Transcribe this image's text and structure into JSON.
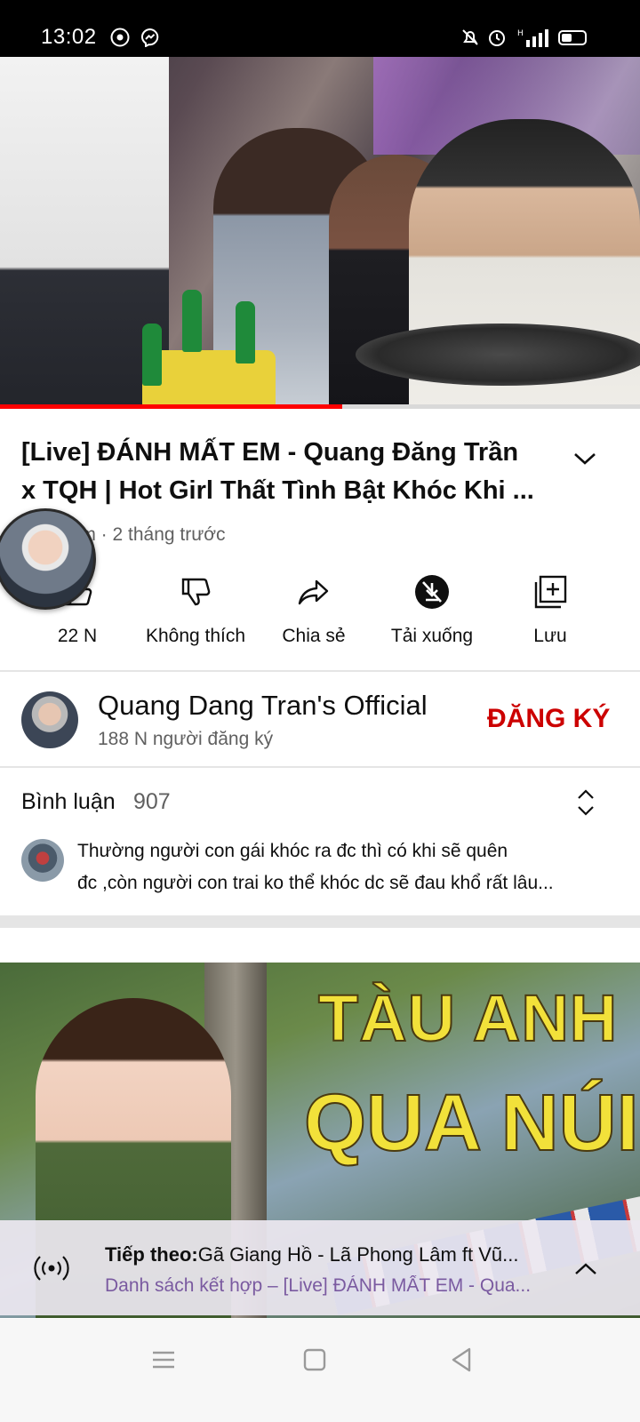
{
  "status_bar": {
    "time": "13:02",
    "icons": [
      "chrome-icon",
      "messenger-icon",
      "mute-icon",
      "alarm-icon",
      "signal-icon",
      "battery-icon"
    ]
  },
  "player": {
    "progress": 0.535,
    "colors": {
      "progress_fill": "#ff0000",
      "progress_track": "#d9d9d9"
    }
  },
  "video": {
    "title_line1": "[Live] ĐÁNH MẤT EM - Quang Đăng Trần",
    "title_line2": "x TQH | Hot Girl Thất Tình Bật Khóc Khi ...",
    "meta": "lượt xem · 2 tháng trước"
  },
  "actions": [
    {
      "label": "22 N",
      "icon": "thumbs-up-icon"
    },
    {
      "label": "Không thích",
      "icon": "thumbs-down-icon"
    },
    {
      "label": "Chia sẻ",
      "icon": "share-icon"
    },
    {
      "label": "Tải xuống",
      "icon": "download-icon"
    },
    {
      "label": "Lưu",
      "icon": "save-playlist-icon"
    }
  ],
  "channel": {
    "name": "Quang Dang Tran's Official",
    "subscribers": "188 N người đăng ký",
    "subscribe_label": "ĐĂNG KÝ",
    "subscribe_color": "#cc0000"
  },
  "comments": {
    "label": "Bình luận",
    "count": "907",
    "top_comment_line1": "Thường người con gái khóc ra đc thì có khi sẽ quên",
    "top_comment_line2": "đc ,còn người con trai ko thể khóc dc sẽ đau khổ rất lâu..."
  },
  "next_thumbnail": {
    "text_line1": "TÀU ANH",
    "text_line2": "QUA NÚI"
  },
  "up_next": {
    "prefix": "Tiếp theo:",
    "title": "Gã Giang Hồ - Lã Phong Lâm ft Vũ...",
    "playlist": "Danh sách kết hợp – [Live] ĐÁNH MẤT EM - Qua..."
  },
  "nav_bar": {
    "buttons": [
      "menu-icon",
      "home-square-icon",
      "back-triangle-icon"
    ]
  }
}
